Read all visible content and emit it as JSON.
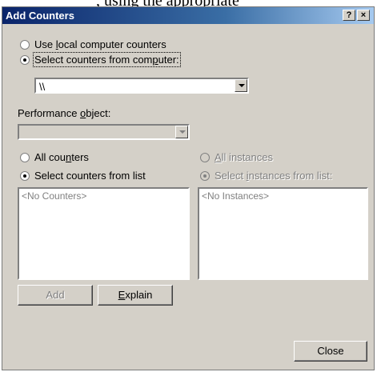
{
  "window": {
    "title": "Add Counters",
    "help_button": "?",
    "close_button": "×"
  },
  "computer_source": {
    "local_option": "Use local computer counters",
    "remote_option": "Select counters from computer:",
    "selected": "remote",
    "computer_value": "\\\\"
  },
  "performance_object": {
    "label": "Performance object:",
    "value": ""
  },
  "counters": {
    "all_option": "All counters",
    "list_option": "Select counters from list",
    "selected": "list",
    "empty_text": "<No Counters>"
  },
  "instances": {
    "all_option": "All instances",
    "list_option": "Select instances from list:",
    "selected": "list",
    "empty_text": "<No Instances>"
  },
  "buttons": {
    "add": "Add",
    "explain": "Explain",
    "close": "Close"
  }
}
